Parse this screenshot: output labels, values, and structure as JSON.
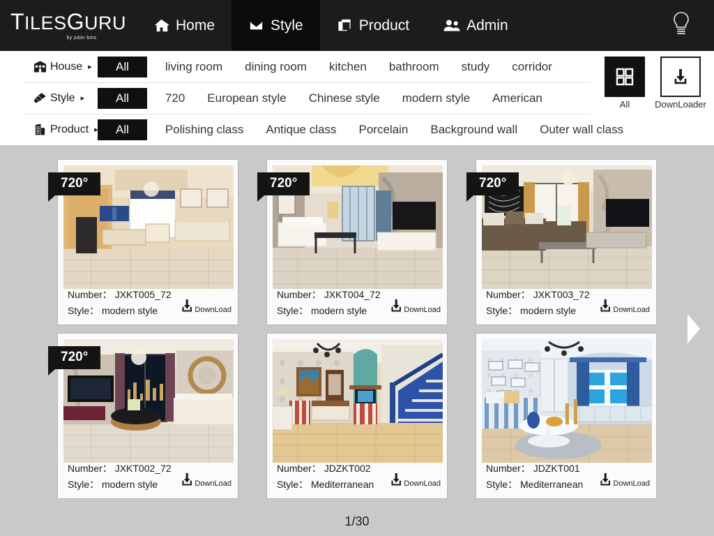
{
  "header": {
    "logo": {
      "text_part1": "T",
      "text_rest": "ILES",
      "text_part2": "G",
      "text_rest2": "URU",
      "full": "TILESGURU",
      "subtitle": "by jubin bms"
    },
    "nav": [
      {
        "label": "Home",
        "icon": "home-icon",
        "active": false
      },
      {
        "label": "Style",
        "icon": "tray-icon",
        "active": true
      },
      {
        "label": "Product",
        "icon": "copy-icon",
        "active": false
      },
      {
        "label": "Admin",
        "icon": "users-icon",
        "active": false
      }
    ],
    "bulb_icon": "lightbulb-icon"
  },
  "filters": {
    "rows": [
      {
        "category": "House",
        "icon": "house-icon",
        "arrow": "▸",
        "options": [
          "All",
          "living room",
          "dining room",
          "kitchen",
          "bathroom",
          "study",
          "corridor"
        ],
        "selected": "All"
      },
      {
        "category": "Style",
        "icon": "brush-icon",
        "arrow": "▸",
        "options": [
          "All",
          "720",
          "European style",
          "Chinese style",
          "modern style",
          "American"
        ],
        "selected": "All"
      },
      {
        "category": "Product",
        "icon": "building-icon",
        "arrow": "▸",
        "options": [
          "All",
          "Polishing class",
          "Antique class",
          "Porcelain",
          "Background wall",
          "Outer wall class"
        ],
        "selected": "All"
      }
    ],
    "side_buttons": [
      {
        "label": "All",
        "icon": "grid-icon",
        "style": "dark"
      },
      {
        "label": "DownLoader",
        "icon": "download-icon",
        "style": "light"
      }
    ]
  },
  "content": {
    "number_label": "Number：",
    "style_label": "Style：",
    "download_label": "DownLoad",
    "badge_text": "720°",
    "cards": [
      {
        "number": "JXKT005_72",
        "style": "modern style",
        "badge": true,
        "scene": "living-room-beige-classic"
      },
      {
        "number": "JXKT004_72",
        "style": "modern style",
        "badge": true,
        "scene": "living-room-marble-tv"
      },
      {
        "number": "JXKT003_72",
        "style": "modern style",
        "badge": true,
        "scene": "living-room-brown-sofa"
      },
      {
        "number": "JXKT002_72",
        "style": "modern style",
        "badge": true,
        "scene": "living-room-night-city"
      },
      {
        "number": "JDZKT002",
        "style": "Mediterranean",
        "badge": false,
        "scene": "living-room-blue-stairs"
      },
      {
        "number": "JDZKT001",
        "style": "Mediterranean",
        "badge": false,
        "scene": "living-room-blue-window"
      }
    ],
    "pagination": "1/30",
    "next_arrow_icon": "next-triangle-icon"
  },
  "colors": {
    "header_bg": "#1c1c1c",
    "active_tab_bg": "#0b0b0b",
    "filter_bg": "#ffffff",
    "selected_chip_bg": "#101010",
    "content_bg": "#c9c9c9",
    "card_bg": "#fbfbfb",
    "badge_bg": "#141414"
  }
}
